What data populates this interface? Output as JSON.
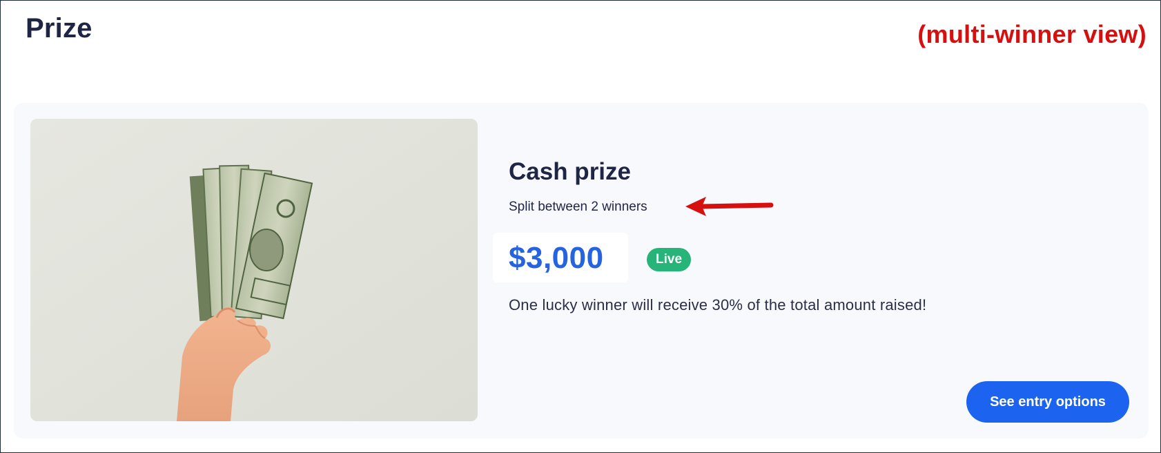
{
  "page": {
    "title": "Prize",
    "annotation": "(multi-winner view)"
  },
  "prize": {
    "name": "Cash prize",
    "split_text": "Split between 2 winners",
    "amount": "$3,000",
    "status_badge": "Live",
    "description": "One lucky winner will receive 30% of the total amount raised!",
    "cta_label": "See entry options",
    "image_subject": "hand-holding-dollar-bills-image"
  },
  "colors": {
    "title_text": "#1e2545",
    "annotation": "#d60f0f",
    "card_background": "#f7f9fd",
    "amount": "#2563df",
    "badge_live": "#27b478",
    "button": "#1c64f0",
    "arrow": "#d60f0f"
  },
  "icons": {
    "callout": "red-arrow-left-icon"
  }
}
